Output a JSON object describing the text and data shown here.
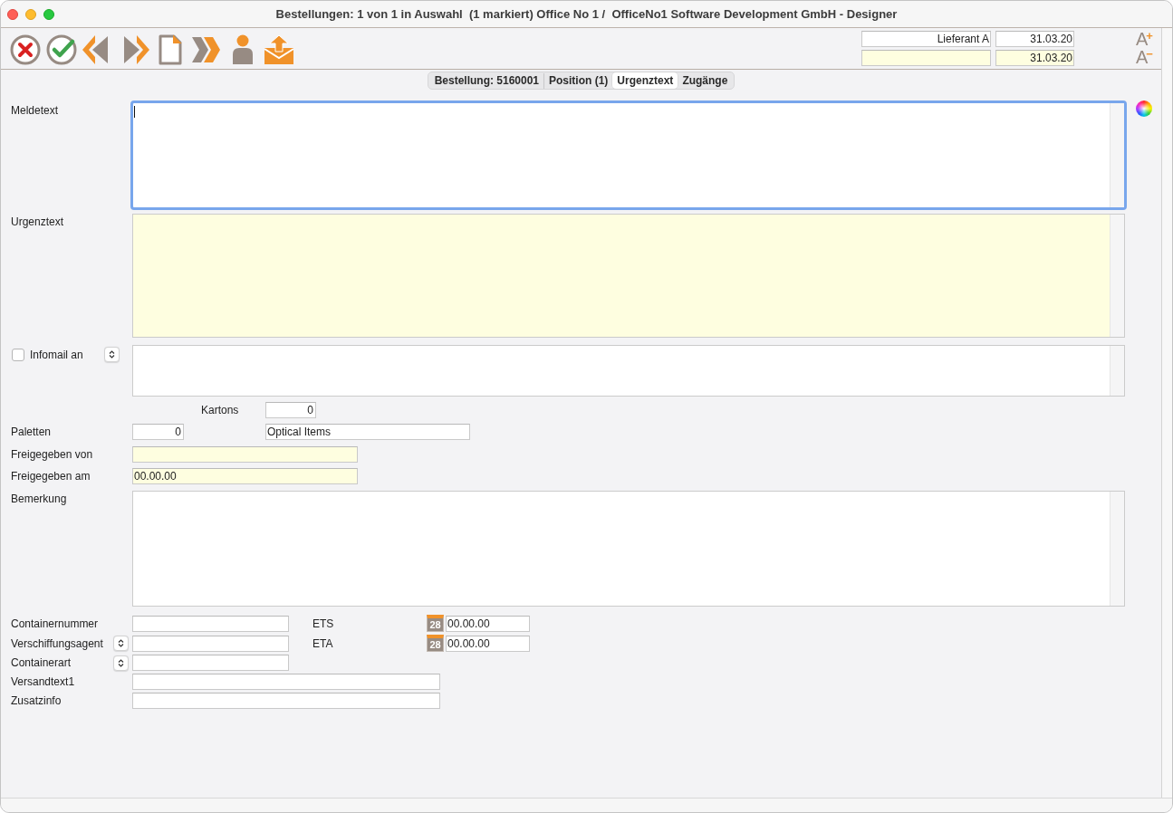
{
  "window": {
    "title": "Bestellungen: 1 von 1 in Auswahl  (1 markiert) Office No 1 /  OfficeNo1 Software Development GmbH - Designer"
  },
  "toolbar": {
    "header_fields": [
      {
        "value": "Lieferant A",
        "highlighted": false
      },
      {
        "value": "31.03.20",
        "highlighted": false
      },
      {
        "highlighted": true
      },
      {
        "value": "31.03.20",
        "highlighted": true
      }
    ],
    "font_size_buttons": [
      {
        "letter": "A",
        "sign": "+"
      },
      {
        "letter": "A",
        "sign": "−"
      }
    ]
  },
  "tabs": [
    {
      "label": "Bestellung: 5160001",
      "selected": false
    },
    {
      "label": "Position (1)",
      "selected": false
    },
    {
      "label": "Urgenztext",
      "selected": true
    },
    {
      "label": "Zugänge",
      "selected": false
    }
  ],
  "form": {
    "meldetext": {
      "label": "Meldetext",
      "focused": true,
      "highlighted": false
    },
    "urgenztext": {
      "label": "Urgenztext",
      "focused": false,
      "highlighted": true
    },
    "infomail": {
      "label": "Infomail an",
      "checked": false,
      "highlighted": false
    },
    "kartons": {
      "label": "Kartons",
      "value": "0",
      "highlighted": false
    },
    "paletten": {
      "label": "Paletten",
      "value": "0",
      "highlighted": false
    },
    "field_2": {
      "value": "Optical Items",
      "highlighted": false
    },
    "freigegeben_von": {
      "label": "Freigegeben von",
      "highlighted": true
    },
    "freigegeben_am": {
      "label": "Freigegeben am",
      "value": "00.00.00",
      "highlighted": true
    },
    "bemerkung": {
      "label": "Bemerkung",
      "focused": false,
      "highlighted": false
    },
    "shipping": [
      {
        "label": "Containernummer",
        "kind": "text",
        "highlighted": false
      },
      {
        "label": "Verschiffungsagent",
        "kind": "select",
        "highlighted": false
      },
      {
        "label": "Containerart",
        "kind": "select",
        "highlighted": false
      },
      {
        "label": "Versandtext1",
        "kind": "text",
        "highlighted": false
      },
      {
        "label": "Zusatzinfo",
        "kind": "text",
        "highlighted": false
      }
    ],
    "dates": [
      {
        "label": "ETS",
        "calendar": "28",
        "value": "00.00.00",
        "highlighted": false
      },
      {
        "label": "ETA",
        "calendar": "28",
        "value": "00.00.00",
        "highlighted": false
      }
    ]
  }
}
